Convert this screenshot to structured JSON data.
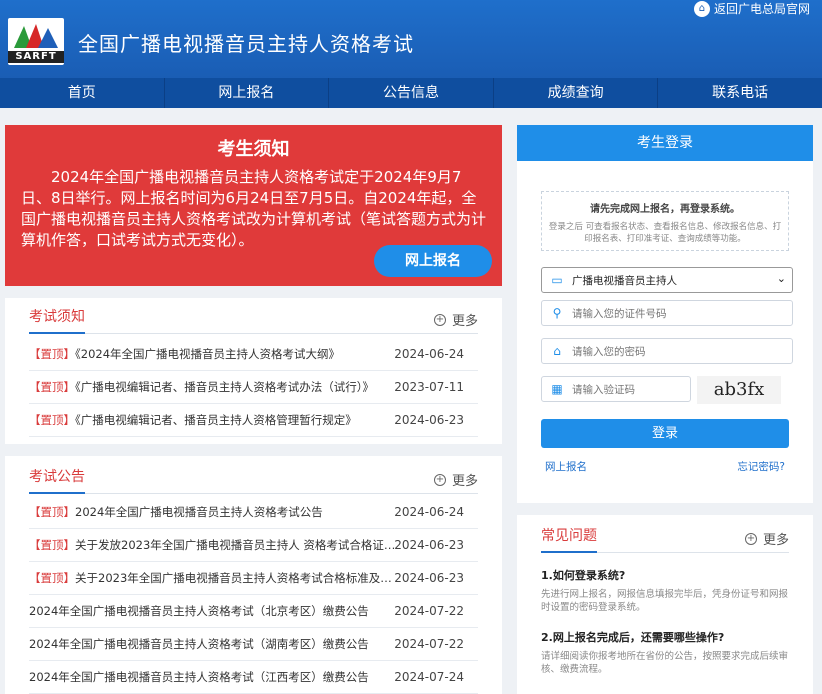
{
  "header": {
    "logo_text": "SARFT",
    "title": "全国广播电视播音员主持人资格考试",
    "return_link": "返回广电总局官网"
  },
  "nav": [
    "首页",
    "网上报名",
    "公告信息",
    "成绩查询",
    "联系电话"
  ],
  "notice": {
    "title": "考生须知",
    "body": "2024年全国广播电视播音员主持人资格考试定于2024年9月7日、8日举行。网上报名时间为6月24日至7月5日。自2024年起，全国广播电视播音员主持人资格考试改为计算机考试（笔试答题方式为计算机作答，口试考试方式无变化）。",
    "button": "网上报名"
  },
  "exam_notice": {
    "title": "考试须知",
    "more": "更多",
    "items": [
      {
        "tag": "【置顶】",
        "title": "《2024年全国广播电视播音员主持人资格考试大纲》",
        "date": "2024-06-24"
      },
      {
        "tag": "【置顶】",
        "title": "《广播电视编辑记者、播音员主持人资格考试办法（试行）》",
        "date": "2023-07-11"
      },
      {
        "tag": "【置顶】",
        "title": "《广播电视编辑记者、播音员主持人资格管理暂行规定》",
        "date": "2024-06-23"
      }
    ]
  },
  "exam_announce": {
    "title": "考试公告",
    "more": "更多",
    "items": [
      {
        "tag": "【置顶】",
        "title": "2024年全国广播电视播音员主持人资格考试公告",
        "date": "2024-06-24"
      },
      {
        "tag": "【置顶】",
        "title": "关于发放2023年全国广播电视播音员主持人 资格考试合格证电...",
        "date": "2024-06-23"
      },
      {
        "tag": "【置顶】",
        "title": "关于2023年全国广播电视播音员主持人资格考试合格标准及有...",
        "date": "2024-06-23"
      },
      {
        "tag": "",
        "title": "2024年全国广播电视播音员主持人资格考试（北京考区）缴费公告",
        "date": "2024-07-22"
      },
      {
        "tag": "",
        "title": "2024年全国广播电视播音员主持人资格考试（湖南考区）缴费公告",
        "date": "2024-07-22"
      },
      {
        "tag": "",
        "title": "2024年全国广播电视播音员主持人资格考试（江西考区）缴费公告",
        "date": "2024-07-24"
      }
    ]
  },
  "login": {
    "title": "考生登录",
    "tip_main": "请先完成网上报名，再登录系统。",
    "tip_sub": "登录之后 可查看报名状态、查看报名信息、修改报名信息、打印报名表、打印准考证、查询成绩等功能。",
    "select_value": "广播电视播音员主持人",
    "id_placeholder": "请输入您的证件号码",
    "password_placeholder": "请输入您的密码",
    "captcha_placeholder": "请输入验证码",
    "captcha_text": "ab3fx",
    "login_button": "登录",
    "register_link": "网上报名",
    "forgot_link": "忘记密码?"
  },
  "faq": {
    "title": "常见问题",
    "more": "更多",
    "items": [
      {
        "q": "1.如何登录系统?",
        "a": "先进行网上报名，网报信息填报完毕后，凭身份证号和网报时设置的密码登录系统。"
      },
      {
        "q": "2.网上报名完成后，还需要哪些操作?",
        "a": "请详细阅读你报考地所在省份的公告，按照要求完成后续审核、缴费流程。"
      }
    ]
  },
  "colors": {
    "primary": "#1f6fcb",
    "nav": "#0f4e9f",
    "notice_red": "#e03a3a",
    "button_blue": "#1f8ee8",
    "tag_red": "#d93b3b"
  }
}
